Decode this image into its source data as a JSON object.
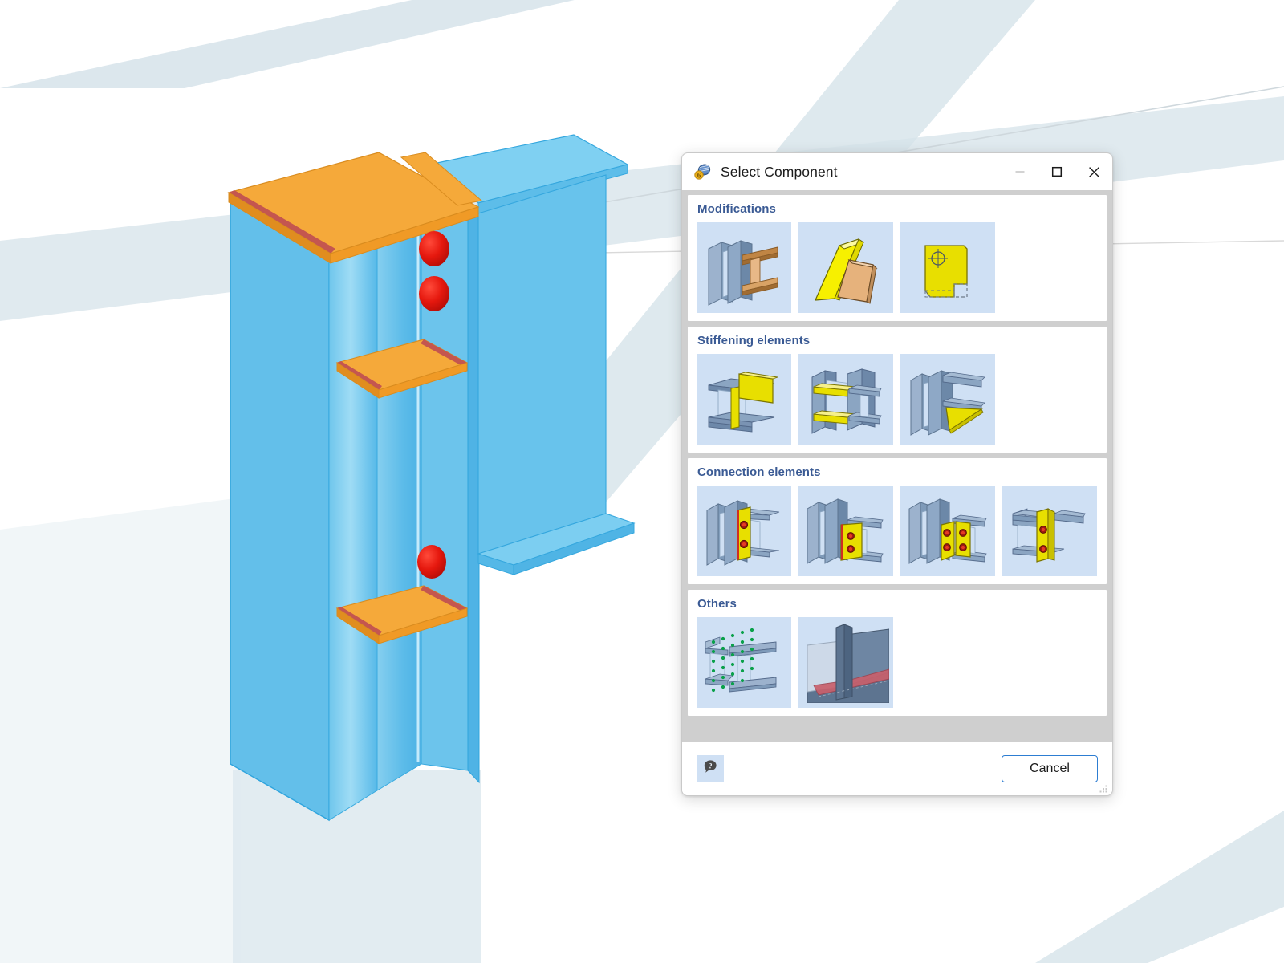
{
  "app": {
    "window_title": "Select Component",
    "app_icon": "component-catalog-icon"
  },
  "titlebar": {
    "minimize_label": "—",
    "minimize_icon": "minimize-icon",
    "maximize_icon": "maximize-icon",
    "close_icon": "close-icon"
  },
  "sections": [
    {
      "id": "modifications",
      "title": "Modifications",
      "tiles": [
        {
          "name": "tile-modification-beam-cut",
          "icon": "beam-through-plates-icon"
        },
        {
          "name": "tile-modification-plate-fold",
          "icon": "yellow-plate-bend-icon"
        },
        {
          "name": "tile-modification-notch",
          "icon": "yellow-plate-notch-icon"
        }
      ]
    },
    {
      "id": "stiffening-elements",
      "title": "Stiffening elements",
      "tiles": [
        {
          "name": "tile-stiffener-web-vertical",
          "icon": "vertical-web-stiffener-icon"
        },
        {
          "name": "tile-stiffener-horizontal-pair",
          "icon": "horizontal-stiffener-pair-icon"
        },
        {
          "name": "tile-stiffener-haunch",
          "icon": "triangular-haunch-icon"
        }
      ]
    },
    {
      "id": "connection-elements",
      "title": "Connection elements",
      "tiles": [
        {
          "name": "tile-connection-end-plate",
          "icon": "end-plate-two-bolts-icon"
        },
        {
          "name": "tile-connection-fin-plate",
          "icon": "fin-plate-two-bolts-icon"
        },
        {
          "name": "tile-connection-splice-plate",
          "icon": "splice-plate-four-bolts-icon"
        },
        {
          "name": "tile-connection-angle-cleat",
          "icon": "angle-cleat-bolts-icon"
        }
      ]
    },
    {
      "id": "others",
      "title": "Others",
      "tiles": [
        {
          "name": "tile-other-bolt-grid",
          "icon": "bolt-grid-pattern-icon"
        },
        {
          "name": "tile-other-weld-seam",
          "icon": "weld-seam-icon"
        }
      ]
    }
  ],
  "footer": {
    "help_icon": "help-question-bubble-icon",
    "cancel_label": "Cancel"
  },
  "colors": {
    "accent_blue": "#2d7dd2",
    "group_title": "#3a5a94",
    "tile_bg": "#cfe0f4",
    "dialog_body": "#cfcfcf",
    "model_steel_blue": "#4fb6e8",
    "model_plate_orange": "#f5a93a",
    "model_bolt_red": "#e01b14",
    "model_weld_red": "#c4564f",
    "grid_band": "#d6e3ea"
  },
  "viewport": {
    "model_name": "steel-beam-column-connection-3d",
    "description": "3D steel column with end plate, horizontal stiffener plates, bolts and connected beam"
  }
}
